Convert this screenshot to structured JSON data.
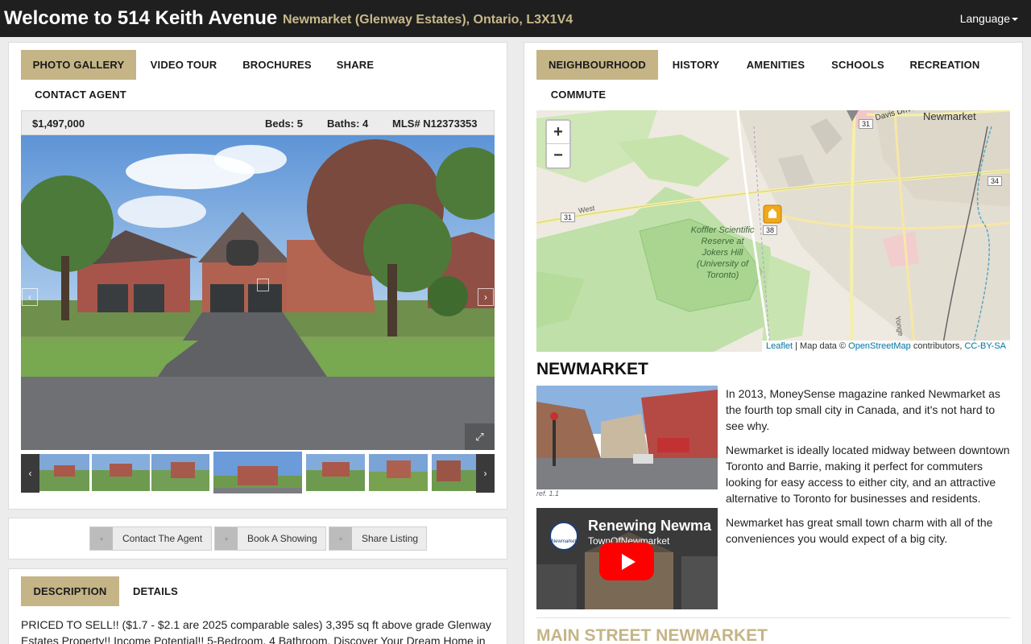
{
  "header": {
    "title": "Welcome to 514 Keith Avenue",
    "subtitle": "Newmarket (Glenway Estates), Ontario, L3X1V4",
    "language_label": "Language"
  },
  "left_tabs": [
    "PHOTO GALLERY",
    "VIDEO TOUR",
    "BROCHURES",
    "SHARE",
    "CONTACT AGENT"
  ],
  "listing": {
    "price": "$1,497,000",
    "beds": "Beds: 5",
    "baths": "Baths: 4",
    "mls": "MLS# N12373353"
  },
  "actions": {
    "contact": "Contact The Agent",
    "book": "Book A Showing",
    "share": "Share Listing"
  },
  "desc_tabs": [
    "DESCRIPTION",
    "DETAILS"
  ],
  "description": "PRICED TO SELL!! ($1.7 - $2.1 are 2025 comparable sales) 3,395 sq ft above grade Glenway Estates Property!! Income Potential!! 5-Bedroom, 4 Bathroom. Discover Your Dream Home in",
  "right_tabs": [
    "NEIGHBOURHOOD",
    "HISTORY",
    "AMENITIES",
    "SCHOOLS",
    "RECREATION",
    "COMMUTE"
  ],
  "map": {
    "zoom_in": "+",
    "zoom_out": "−",
    "place_label": "Newmarket",
    "road_davis": "Davis Drive",
    "road_31_a": "31",
    "road_31_b": "31",
    "road_34": "34",
    "road_38": "38",
    "west_label": "West",
    "yonge_label": "Yonge",
    "reserve_label": "Koffler Scientific Reserve at Jokers Hill (University of Toronto)",
    "attribution": {
      "leaflet": "Leaflet",
      "mid": " | Map data © ",
      "osm": "OpenStreetMap",
      "contrib": " contributors, ",
      "license": "CC-BY-SA"
    }
  },
  "neighbourhood": {
    "title": "NEWMARKET",
    "ref": "ref. 1.1",
    "paragraphs": [
      "In 2013, MoneySense magazine ranked Newmarket as the fourth top small city in Canada, and it's not hard to see why.",
      "Newmarket is ideally located midway between downtown Toronto and Barrie, making it perfect for commuters looking for easy access to either city, and an attractive alternative to Toronto for businesses and residents.",
      "Newmarket has great small town charm with all of the conveniences you would expect of a big city."
    ],
    "video": {
      "title": "Renewing Newma",
      "channel": "TownOfNewmarket",
      "logo_text": "Newmarket"
    },
    "next_title": "MAIN STREET NEWMARKET"
  },
  "icons": {
    "prev": "‹",
    "next": "›",
    "fullscreen": "⤢",
    "btn_icon": "▫"
  },
  "colors": {
    "accent": "#c4b486",
    "header_bg": "#1f1f1f",
    "youtube_red": "#ff0000"
  }
}
